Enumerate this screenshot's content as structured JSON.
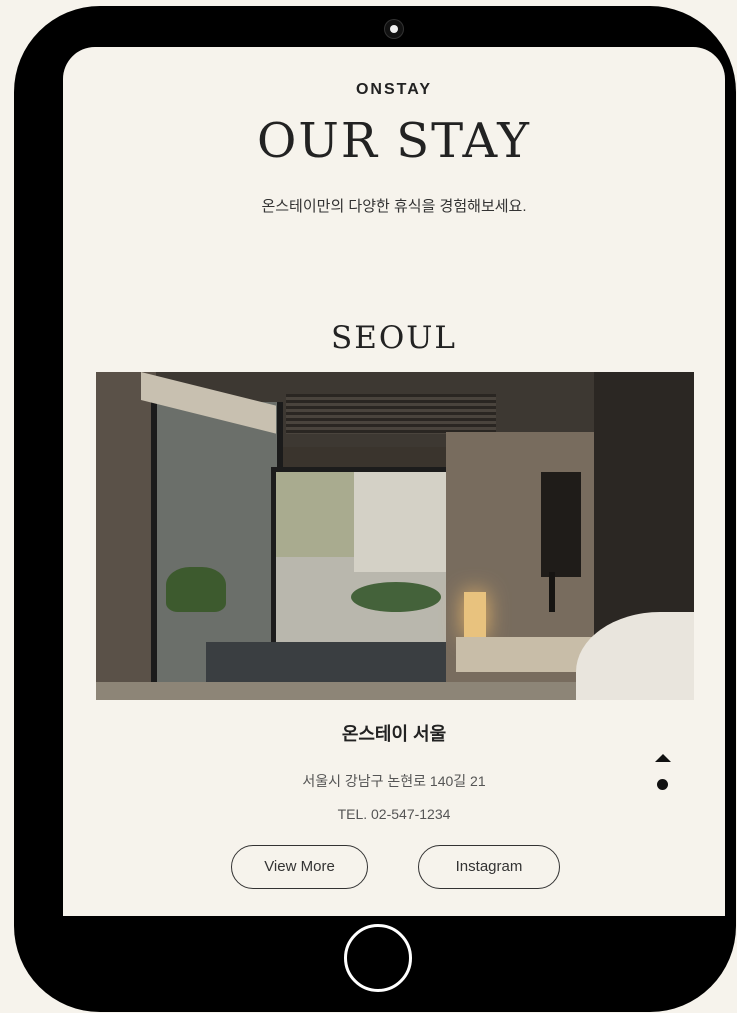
{
  "header": {
    "brand": "ONSTAY",
    "title": "OUR STAY",
    "subtitle": "온스테이만의 다양한 휴식을 경험해보세요."
  },
  "location": {
    "city": "SEOUL",
    "photo_icon": "room-photo",
    "stay_name": "온스테이 서울",
    "address": "서울시 강남구 논현로 140길 21",
    "tel": "TEL. 02-547-1234"
  },
  "actions": {
    "view_more": "View More",
    "instagram": "Instagram"
  },
  "controls": {
    "scroll_top_icon": "caret-up-icon",
    "indicator_icon": "dot-icon",
    "home_icon": "home-button"
  },
  "colors": {
    "background": "#f6f3ec",
    "device": "#000000",
    "text": "#222222"
  }
}
